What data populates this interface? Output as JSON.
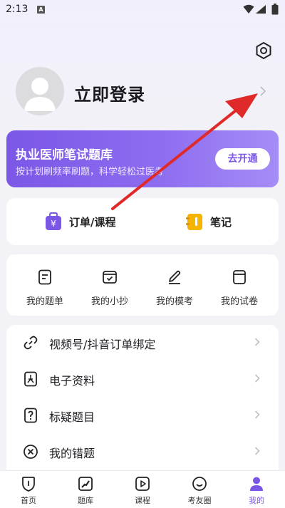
{
  "status_bar": {
    "time": "2:13",
    "notification_badge": "A",
    "icons": [
      "wifi-icon",
      "signal-icon",
      "battery-icon"
    ]
  },
  "header": {
    "settings_icon": "settings-icon"
  },
  "profile": {
    "login_text": "立即登录",
    "avatar_icon": "default-avatar"
  },
  "vip_banner": {
    "title": "执业医师笔试题库",
    "subtitle": "按计划刷频率刷题，科学轻松过医考",
    "button": "去开通"
  },
  "quick_links": [
    {
      "label": "订单/课程",
      "icon": "order-bag-icon"
    },
    {
      "label": "笔记",
      "icon": "notebook-icon"
    }
  ],
  "my_items": [
    {
      "label": "我的题单",
      "icon": "question-list-icon"
    },
    {
      "label": "我的小抄",
      "icon": "cheat-sheet-icon"
    },
    {
      "label": "我的模考",
      "icon": "pen-icon"
    },
    {
      "label": "我的试卷",
      "icon": "paper-icon"
    }
  ],
  "list_items": [
    {
      "label": "视频号/抖音订单绑定",
      "icon": "link-icon"
    },
    {
      "label": "电子资料",
      "icon": "pdf-icon"
    },
    {
      "label": "标疑题目",
      "icon": "question-mark-icon"
    },
    {
      "label": "我的错题",
      "icon": "wrong-x-icon"
    }
  ],
  "tabs": [
    {
      "label": "首页",
      "icon": "home-icon",
      "active": false
    },
    {
      "label": "题库",
      "icon": "question-bank-icon",
      "active": false
    },
    {
      "label": "课程",
      "icon": "course-play-icon",
      "active": false
    },
    {
      "label": "考友圈",
      "icon": "community-icon",
      "active": false
    },
    {
      "label": "我的",
      "icon": "profile-icon",
      "active": true
    }
  ],
  "colors": {
    "accent": "#7b57e6",
    "banner_gradient_start": "#7b57e6",
    "banner_gradient_end": "#a58cf6",
    "annotation_arrow": "#e02a2a",
    "notes_icon": "#f4b400"
  }
}
